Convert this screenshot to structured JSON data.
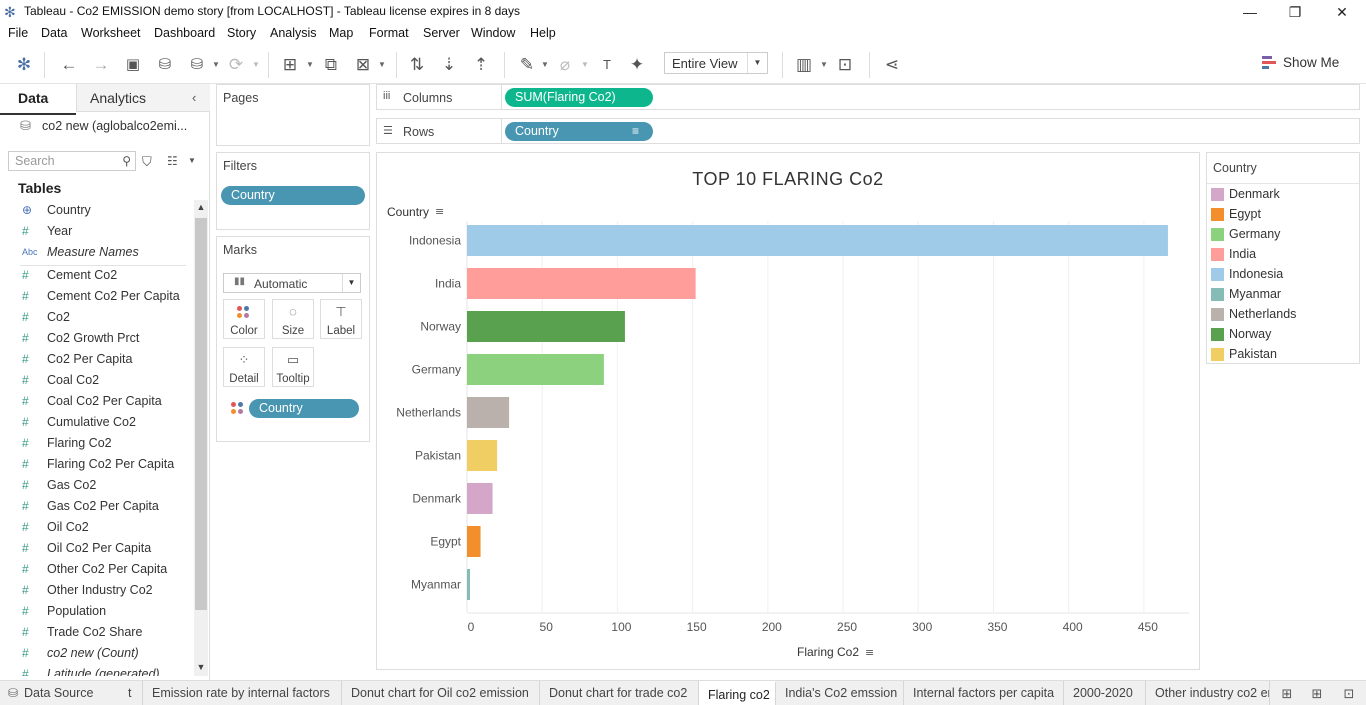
{
  "window": {
    "title": "Tableau - Co2 EMISSION demo story [from LOCALHOST] - Tableau license expires in 8 days"
  },
  "menu": [
    "File",
    "Data",
    "Worksheet",
    "Dashboard",
    "Story",
    "Analysis",
    "Map",
    "Format",
    "Server",
    "Window",
    "Help"
  ],
  "toolbar": {
    "view_mode": "Entire View",
    "show_me": "Show Me"
  },
  "data_pane": {
    "tab_data": "Data",
    "tab_analytics": "Analytics",
    "datasource": "co2 new (aglobalco2emi...",
    "search_placeholder": "Search",
    "tables_header": "Tables",
    "fields": [
      {
        "name": "Country",
        "icon": "globe-icon"
      },
      {
        "name": "Year",
        "icon": "hash-icon"
      },
      {
        "name": "Measure Names",
        "icon": "abc-icon"
      },
      {
        "name": "Cement Co2",
        "icon": "hash-icon"
      },
      {
        "name": "Cement Co2 Per Capita",
        "icon": "hash-icon"
      },
      {
        "name": "Co2",
        "icon": "hash-icon"
      },
      {
        "name": "Co2 Growth Prct",
        "icon": "hash-icon"
      },
      {
        "name": "Co2 Per Capita",
        "icon": "hash-icon"
      },
      {
        "name": "Coal Co2",
        "icon": "hash-icon"
      },
      {
        "name": "Coal Co2 Per Capita",
        "icon": "hash-icon"
      },
      {
        "name": "Cumulative Co2",
        "icon": "hash-icon"
      },
      {
        "name": "Flaring Co2",
        "icon": "hash-icon"
      },
      {
        "name": "Flaring Co2 Per Capita",
        "icon": "hash-icon"
      },
      {
        "name": "Gas Co2",
        "icon": "hash-icon"
      },
      {
        "name": "Gas Co2 Per Capita",
        "icon": "hash-icon"
      },
      {
        "name": "Oil Co2",
        "icon": "hash-icon"
      },
      {
        "name": "Oil Co2 Per Capita",
        "icon": "hash-icon"
      },
      {
        "name": "Other Co2 Per Capita",
        "icon": "hash-icon"
      },
      {
        "name": "Other Industry Co2",
        "icon": "hash-icon"
      },
      {
        "name": "Population",
        "icon": "hash-icon"
      },
      {
        "name": "Trade Co2 Share",
        "icon": "hash-icon"
      },
      {
        "name": "co2 new (Count)",
        "icon": "hash-icon"
      },
      {
        "name": "Latitude (generated)",
        "icon": "hash-icon"
      }
    ]
  },
  "cards": {
    "pages": "Pages",
    "filters": "Filters",
    "filter_pill": "Country",
    "marks": "Marks",
    "marks_type": "Automatic",
    "mark_buttons": [
      "Color",
      "Size",
      "Label",
      "Detail",
      "Tooltip"
    ],
    "marks_pill": "Country"
  },
  "shelves": {
    "columns_label": "Columns",
    "columns_pill": "SUM(Flaring Co2)",
    "rows_label": "Rows",
    "rows_pill": "Country"
  },
  "viz": {
    "title": "TOP 10 FLARING Co2",
    "row_header": "Country",
    "x_axis_label": "Flaring Co2"
  },
  "chart_data": {
    "type": "bar",
    "orientation": "horizontal",
    "title": "TOP 10 FLARING Co2",
    "xlabel": "Flaring Co2",
    "ylabel": "Country",
    "categories": [
      "Indonesia",
      "India",
      "Norway",
      "Germany",
      "Netherlands",
      "Pakistan",
      "Denmark",
      "Egypt",
      "Myanmar"
    ],
    "values": [
      466,
      152,
      105,
      91,
      28,
      20,
      17,
      9,
      2
    ],
    "colors": [
      "#a0cbe8",
      "#ff9d9a",
      "#59a14f",
      "#8cd17d",
      "#bab0ac",
      "#f1ce63",
      "#d4a6c8",
      "#f28e2b",
      "#86bcb6"
    ],
    "xlim": [
      0,
      480
    ],
    "xticks": [
      0,
      50,
      100,
      150,
      200,
      250,
      300,
      350,
      400,
      450
    ],
    "grid": true,
    "legend": "right"
  },
  "legend": {
    "title": "Country",
    "items": [
      {
        "label": "Denmark",
        "color": "#d4a6c8"
      },
      {
        "label": "Egypt",
        "color": "#f28e2b"
      },
      {
        "label": "Germany",
        "color": "#8cd17d"
      },
      {
        "label": "India",
        "color": "#ff9d9a"
      },
      {
        "label": "Indonesia",
        "color": "#a0cbe8"
      },
      {
        "label": "Myanmar",
        "color": "#86bcb6"
      },
      {
        "label": "Netherlands",
        "color": "#bab0ac"
      },
      {
        "label": "Norway",
        "color": "#59a14f"
      },
      {
        "label": "Pakistan",
        "color": "#f1ce63"
      }
    ]
  },
  "sheet_tabs": {
    "data_source": "Data Source",
    "tabs": [
      "t",
      "Emission rate by internal factors",
      "Donut chart for Oil co2 emission",
      "Donut chart for trade co2",
      "Flaring co2",
      "India's Co2 emssion",
      "Internal factors per capita",
      "2000-2020",
      "Other industry co2 em"
    ],
    "active": "Flaring co2"
  }
}
